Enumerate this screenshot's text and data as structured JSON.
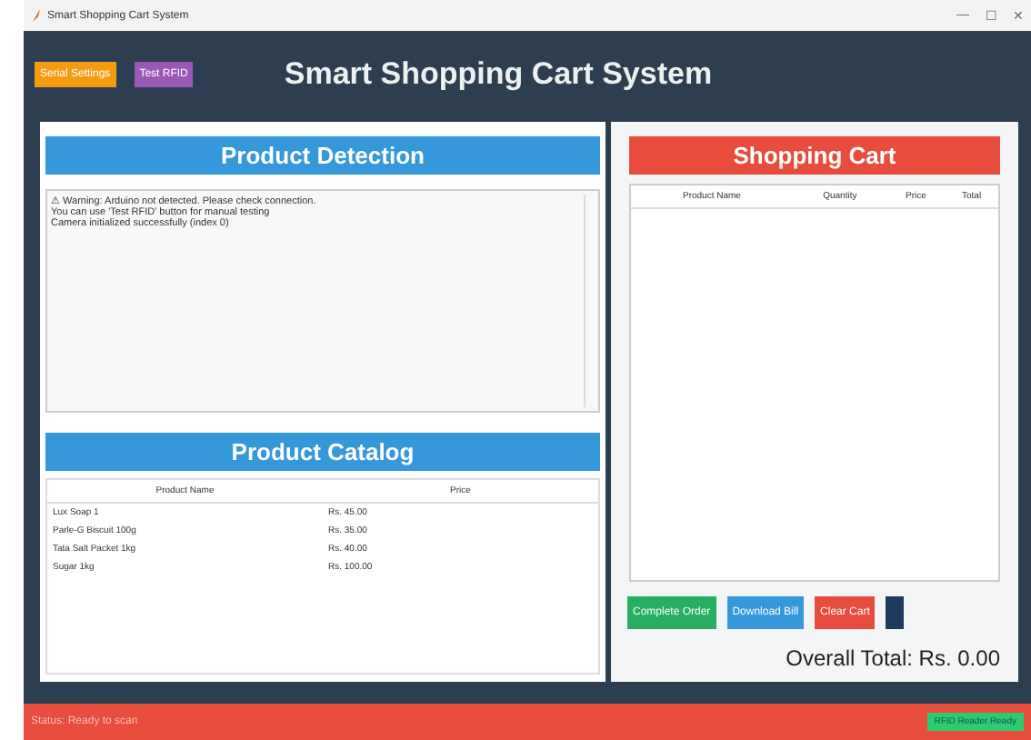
{
  "window": {
    "title": "Smart Shopping Cart System",
    "controls": [
      "—",
      "☐",
      "✕"
    ]
  },
  "header": {
    "buttons": [
      {
        "label": "Serial Settings",
        "kind": "orange"
      },
      {
        "label": "Test RFID",
        "kind": "purple"
      }
    ],
    "title": "Smart Shopping Cart System"
  },
  "detection": {
    "title": "Product Detection",
    "log": [
      "⚠ Warning: Arduino not detected. Please check connection.",
      "You can use 'Test RFID' button for manual testing",
      "Camera initialized successfully (index 0)"
    ]
  },
  "catalog": {
    "title": "Product Catalog",
    "columns": [
      "Product Name",
      "Price"
    ],
    "rows": [
      [
        "Lux Soap 1",
        "Rs. 45.00"
      ],
      [
        "Parle-G Biscuit 100g",
        "Rs. 35.00"
      ],
      [
        "Tata Salt Packet 1kg",
        "Rs. 40.00"
      ],
      [
        "Sugar 1kg",
        "Rs. 100.00"
      ]
    ]
  },
  "cart": {
    "title": "Shopping Cart",
    "columns": [
      "Product Name",
      "Quantity",
      "Price",
      "Total"
    ],
    "buttons": [
      {
        "label": "Complete Order",
        "kind": "green"
      },
      {
        "label": "Download Bill",
        "kind": "blue"
      },
      {
        "label": "Clear Cart",
        "kind": "red"
      },
      {
        "kind": "navy"
      }
    ],
    "total": "Overall Total: Rs. 0.00"
  },
  "status_bar": {
    "message": "Status: Ready to scan",
    "badge": "RFID Reader Ready"
  }
}
